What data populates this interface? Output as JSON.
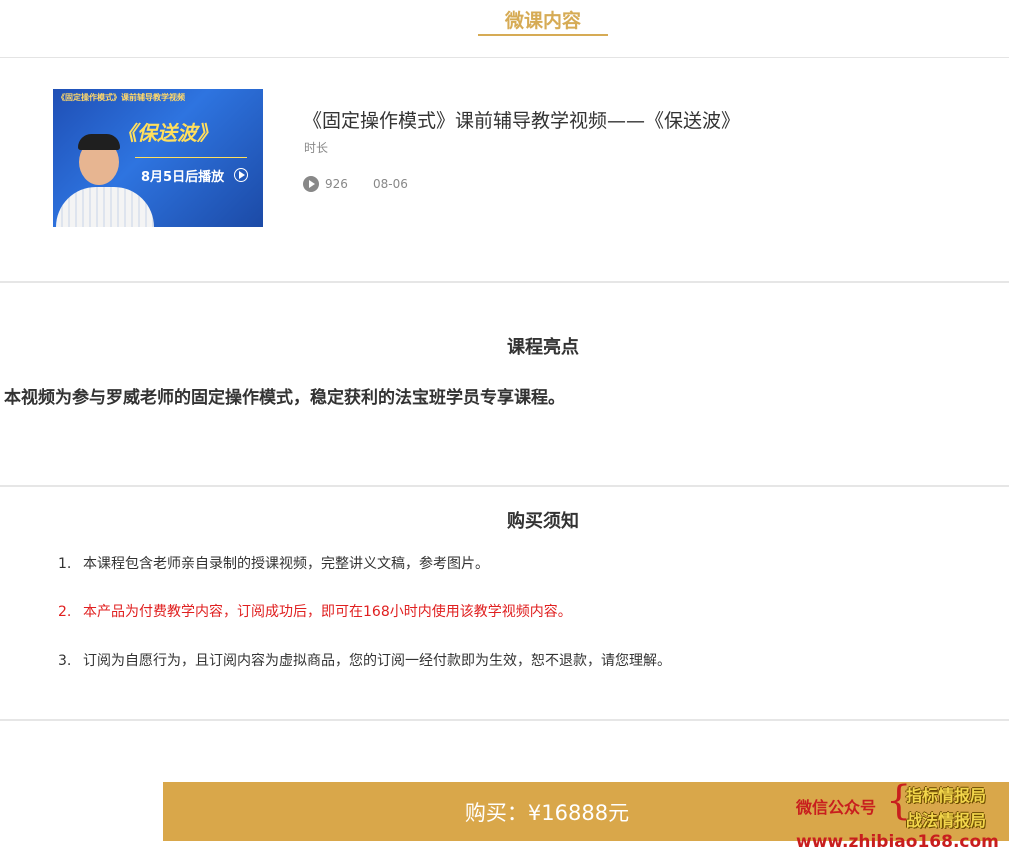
{
  "tab": {
    "label": "微课内容"
  },
  "video": {
    "thumbnail": {
      "banner_top": "《固定操作模式》课前辅导教学视频",
      "big_title": "《保送波》",
      "sub_title": "8月5日后播放"
    },
    "title": "《固定操作模式》课前辅导教学视频——《保送波》",
    "duration_label": "时长",
    "play_count": "926",
    "date": "08-06"
  },
  "highlights": {
    "title": "课程亮点",
    "text": "本视频为参与罗威老师的固定操作模式，稳定获利的法宝班学员专享课程。"
  },
  "purchase_notes": {
    "title": "购买须知",
    "items": [
      {
        "num": "1.",
        "text": "本课程包含老师亲自录制的授课视频，完整讲义文稿，参考图片。"
      },
      {
        "num": "2.",
        "text": "本产品为付费教学内容，订阅成功后，即可在168小时内使用该教学视频内容。"
      },
      {
        "num": "3.",
        "text": "订阅为自愿行为，且订阅内容为虚拟商品，您的订阅一经付款即为生效，恕不退款，请您理解。"
      }
    ]
  },
  "buy": {
    "label": "购买：¥16888元"
  },
  "watermark": {
    "label": "微信公众号",
    "brace": "{",
    "line1": "指标情报局",
    "line2": "战法情报局",
    "url": "www.zhibiao168.com"
  },
  "colors": {
    "accent": "#d6ab55",
    "buy_bg": "#d9a74a",
    "warning": "#e02020"
  }
}
